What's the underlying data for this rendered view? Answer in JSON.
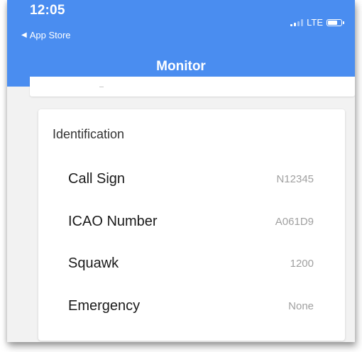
{
  "status_bar": {
    "time": "12:05",
    "back_label": "App Store",
    "network": "LTE"
  },
  "nav": {
    "title": "Monitor"
  },
  "identification": {
    "title": "Identification",
    "rows": [
      {
        "label": "Call Sign",
        "value": "N12345"
      },
      {
        "label": "ICAO Number",
        "value": "A061D9"
      },
      {
        "label": "Squawk",
        "value": "1200"
      },
      {
        "label": "Emergency",
        "value": "None"
      }
    ]
  },
  "colors": {
    "header": "#4a8df0",
    "background": "#f2f2f2",
    "card": "#ffffff",
    "value_text": "#a0a0a0"
  }
}
